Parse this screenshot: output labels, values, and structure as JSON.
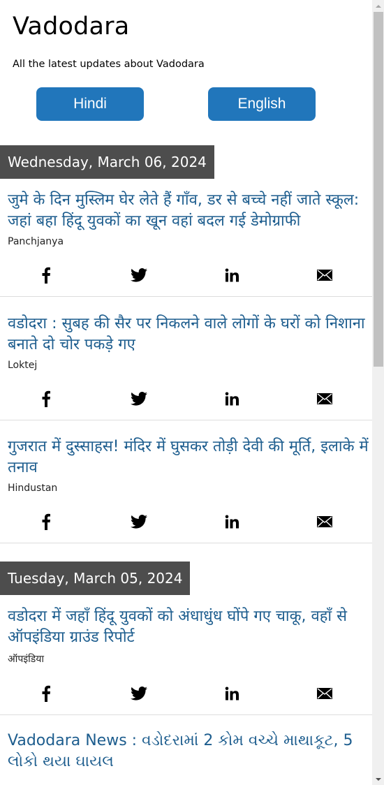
{
  "site": {
    "title": "Vadodara",
    "description": "All the latest updates about Vadodara"
  },
  "language_buttons": {
    "hindi": "Hindi",
    "english": "English"
  },
  "colors": {
    "button_bg": "#2176bb",
    "date_header_bg": "#4d4d4d",
    "article_link": "#1d5d8e"
  },
  "sections": [
    {
      "date": "Wednesday, March 06, 2024",
      "articles": [
        {
          "title": "जुमे के दिन मुस्लिम घेर लेते हैं गाँव, डर से बच्चे नहीं जाते स्कूल: जहां बहा हिंदू युवकों का खून वहां बदल गई डेमोग्राफी",
          "source": "Panchjanya"
        },
        {
          "title": "वडोदरा : सुबह की सैर पर निकलने वाले लोगों के घरों को निशाना बनाते दो चोर पकड़े गए",
          "source": "Loktej"
        },
        {
          "title": "गुजरात में दुस्साहस! मंदिर में घुसकर तोड़ी देवी की मूर्ति, इलाके में तनाव",
          "source": "Hindustan"
        }
      ]
    },
    {
      "date": "Tuesday, March 05, 2024",
      "articles": [
        {
          "title": "वडोदरा में जहाँ हिंदू युवकों को अंधाधुंध घोंपे गए चाकू, वहाँ से ऑपइंडिया ग्राउंड रिपोर्ट",
          "source": "ऑपइंडिया"
        },
        {
          "title": "Vadodara News : વડોદરામાં 2 કોમ વચ્ચે માથાકૂટ, 5 લોકો થયા ઘાયલ",
          "source": ""
        }
      ]
    }
  ],
  "share_icons": [
    "facebook-icon",
    "twitter-icon",
    "linkedin-icon",
    "email-icon"
  ]
}
